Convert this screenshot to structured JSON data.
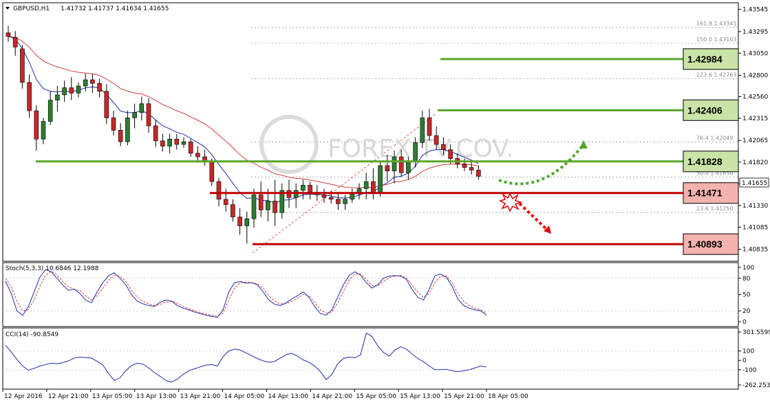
{
  "colors": {
    "bull": "#2e7d32",
    "bear": "#c62828",
    "ma_fast": "#1f2aa8",
    "ma_slow": "#d63b3b",
    "support": "#c00000",
    "resistance": "#5aa42a",
    "box_green": "#c9e4a6",
    "box_red": "#f5b3ad",
    "stoch_main": "#1f2aa8",
    "stoch_signal": "#d63b3b",
    "cci": "#1f2aa8",
    "grid": "#c8c8c8"
  },
  "header": {
    "symbol": "GBPUSD,H1",
    "ohlc": "1.41732 1.41737 1.41634 1.41655"
  },
  "watermark": "FOREX.TV.COV.",
  "price_axis": {
    "min": 1.407,
    "max": 1.4362,
    "ticks": [
      "1.43545",
      "1.43295",
      "1.43050",
      "1.42800",
      "1.42560",
      "1.42315",
      "1.42065",
      "1.41820",
      "1.41575",
      "1.41330",
      "1.41085",
      "1.40835"
    ],
    "current": "1.41655"
  },
  "time_axis": [
    "12 Apr 2016",
    "12 Apr 21:00",
    "13 Apr 05:00",
    "13 Apr 13:00",
    "13 Apr 21:00",
    "14 Apr 05:00",
    "14 Apr 13:00",
    "14 Apr 21:00",
    "15 Apr 05:00",
    "15 Apr 13:00",
    "15 Apr 21:00",
    "18 Apr 05:00"
  ],
  "fib_levels": [
    {
      "label": "161.8  1.43341",
      "price": 1.43341
    },
    {
      "label": "150.0  1.43163",
      "price": 1.43163
    },
    {
      "label": "123.6  1.42763",
      "price": 1.42763
    },
    {
      "label": "76.4  1.42049",
      "price": 1.42049
    },
    {
      "label": "50.0  1.41650",
      "price": 1.4165
    },
    {
      "label": "23.6  1.41250",
      "price": 1.4125
    }
  ],
  "key_levels": [
    {
      "value": "1.42984",
      "price": 1.42984,
      "kind": "resistance"
    },
    {
      "value": "1.42406",
      "price": 1.42406,
      "kind": "resistance"
    },
    {
      "value": "1.41828",
      "price": 1.41828,
      "kind": "resistance"
    },
    {
      "value": "1.41471",
      "price": 1.41471,
      "kind": "support"
    },
    {
      "value": "1.40893",
      "price": 1.40893,
      "kind": "support"
    }
  ],
  "stoch": {
    "label": "Stoch(5,3,3) 10.6846 12.1988",
    "ticks": [
      "100",
      "80",
      "50",
      "20",
      "0"
    ],
    "main": [
      75,
      52,
      20,
      12,
      28,
      55,
      82,
      96,
      92,
      80,
      68,
      58,
      60,
      52,
      40,
      35,
      55,
      72,
      85,
      90,
      80,
      68,
      50,
      38,
      33,
      30,
      28,
      36,
      40,
      38,
      30,
      25,
      22,
      18,
      15,
      12,
      10,
      8,
      22,
      55,
      72,
      74,
      71,
      72,
      68,
      55,
      40,
      32,
      30,
      35,
      42,
      48,
      55,
      45,
      28,
      15,
      12,
      22,
      45,
      68,
      85,
      92,
      86,
      72,
      62,
      68,
      80,
      84,
      85,
      84,
      78,
      60,
      45,
      40,
      60,
      85,
      88,
      82,
      65,
      42,
      30,
      25,
      22,
      20,
      12
    ],
    "signal": [
      80,
      65,
      38,
      20,
      22,
      40,
      65,
      86,
      93,
      86,
      74,
      64,
      60,
      57,
      48,
      40,
      48,
      62,
      76,
      85,
      84,
      74,
      58,
      45,
      38,
      33,
      30,
      32,
      36,
      38,
      34,
      28,
      24,
      20,
      17,
      14,
      12,
      10,
      16,
      40,
      62,
      72,
      73,
      72,
      70,
      62,
      48,
      38,
      33,
      33,
      38,
      44,
      50,
      48,
      36,
      22,
      16,
      18,
      35,
      56,
      76,
      88,
      88,
      78,
      67,
      66,
      74,
      81,
      84,
      85,
      81,
      68,
      54,
      45,
      52,
      72,
      84,
      84,
      72,
      52,
      38,
      30,
      25,
      22,
      16
    ]
  },
  "cci": {
    "label": "CCI(14) -90.8549",
    "ticks": [
      "301.5599",
      "100",
      "0",
      "-100",
      "-262.2536"
    ],
    "values": [
      160,
      90,
      10,
      -60,
      -105,
      -85,
      -60,
      -45,
      -30,
      -35,
      -25,
      -5,
      25,
      35,
      30,
      25,
      -10,
      -50,
      -140,
      -215,
      -185,
      -110,
      -55,
      -30,
      -40,
      -80,
      -130,
      -170,
      -215,
      -230,
      -200,
      -150,
      -110,
      -90,
      -70,
      -50,
      -45,
      -60,
      40,
      100,
      120,
      110,
      80,
      50,
      20,
      -5,
      -20,
      -10,
      25,
      60,
      75,
      45,
      5,
      -20,
      -60,
      -120,
      -205,
      -150,
      -40,
      20,
      35,
      28,
      58,
      290,
      255,
      155,
      85,
      45,
      110,
      145,
      120,
      70,
      20,
      -15,
      -60,
      -100,
      -100,
      -95,
      -110,
      -120,
      -110,
      -100,
      -80,
      -60,
      -70
    ]
  },
  "candles": [
    [
      1.4328,
      1.4336,
      1.4318,
      1.4324
    ],
    [
      1.4323,
      1.433,
      1.4302,
      1.4312
    ],
    [
      1.431,
      1.4314,
      1.4265,
      1.4272
    ],
    [
      1.4272,
      1.4281,
      1.4232,
      1.424
    ],
    [
      1.424,
      1.4246,
      1.4195,
      1.4208
    ],
    [
      1.4208,
      1.4232,
      1.4202,
      1.4228
    ],
    [
      1.4228,
      1.4262,
      1.4224,
      1.4252
    ],
    [
      1.4252,
      1.4268,
      1.4239,
      1.4258
    ],
    [
      1.4258,
      1.4274,
      1.425,
      1.4266
    ],
    [
      1.4266,
      1.4278,
      1.4252,
      1.426
    ],
    [
      1.426,
      1.4272,
      1.4255,
      1.4268
    ],
    [
      1.4268,
      1.4282,
      1.4262,
      1.4275
    ],
    [
      1.4275,
      1.4282,
      1.426,
      1.4271
    ],
    [
      1.4271,
      1.4276,
      1.4255,
      1.4262
    ],
    [
      1.4262,
      1.427,
      1.4225,
      1.4232
    ],
    [
      1.4232,
      1.424,
      1.4212,
      1.4218
    ],
    [
      1.4218,
      1.4226,
      1.42,
      1.4205
    ],
    [
      1.4205,
      1.424,
      1.4201,
      1.4232
    ],
    [
      1.4232,
      1.4248,
      1.422,
      1.4238
    ],
    [
      1.4238,
      1.4256,
      1.4229,
      1.4248
    ],
    [
      1.4248,
      1.4254,
      1.4215,
      1.4223
    ],
    [
      1.4223,
      1.423,
      1.4199,
      1.4206
    ],
    [
      1.4206,
      1.4214,
      1.4194,
      1.42
    ],
    [
      1.42,
      1.4214,
      1.4192,
      1.4208
    ],
    [
      1.4208,
      1.4214,
      1.4196,
      1.4202
    ],
    [
      1.4202,
      1.421,
      1.4198,
      1.4205
    ],
    [
      1.4205,
      1.4208,
      1.4188,
      1.4192
    ],
    [
      1.4192,
      1.42,
      1.4184,
      1.4188
    ],
    [
      1.4188,
      1.4196,
      1.4178,
      1.4182
    ],
    [
      1.4182,
      1.4186,
      1.4155,
      1.416
    ],
    [
      1.416,
      1.4164,
      1.4132,
      1.414
    ],
    [
      1.414,
      1.4152,
      1.4126,
      1.4134
    ],
    [
      1.4134,
      1.414,
      1.4115,
      1.412
    ],
    [
      1.412,
      1.413,
      1.41,
      1.411
    ],
    [
      1.411,
      1.4126,
      1.409,
      1.4118
    ],
    [
      1.4118,
      1.4152,
      1.4108,
      1.4145
    ],
    [
      1.4145,
      1.416,
      1.412,
      1.4128
    ],
    [
      1.4128,
      1.4152,
      1.4115,
      1.4138
    ],
    [
      1.4138,
      1.4162,
      1.411,
      1.4125
    ],
    [
      1.4125,
      1.4158,
      1.4118,
      1.415
    ],
    [
      1.415,
      1.4162,
      1.413,
      1.4142
    ],
    [
      1.4142,
      1.4158,
      1.413,
      1.415
    ],
    [
      1.415,
      1.4162,
      1.414,
      1.4156
    ],
    [
      1.4156,
      1.416,
      1.414,
      1.4148
    ],
    [
      1.4148,
      1.4156,
      1.4138,
      1.4145
    ],
    [
      1.4145,
      1.4152,
      1.4136,
      1.4142
    ],
    [
      1.4142,
      1.415,
      1.4135,
      1.414
    ],
    [
      1.414,
      1.4146,
      1.4128,
      1.4135
    ],
    [
      1.4135,
      1.4145,
      1.4128,
      1.414
    ],
    [
      1.414,
      1.4152,
      1.4136,
      1.4146
    ],
    [
      1.4146,
      1.4158,
      1.414,
      1.4152
    ],
    [
      1.4152,
      1.417,
      1.414,
      1.416
    ],
    [
      1.416,
      1.4175,
      1.414,
      1.4148
    ],
    [
      1.4148,
      1.4182,
      1.4143,
      1.4178
    ],
    [
      1.4178,
      1.419,
      1.416,
      1.4172
    ],
    [
      1.4172,
      1.4195,
      1.4158,
      1.4188
    ],
    [
      1.4188,
      1.4196,
      1.4165,
      1.417
    ],
    [
      1.417,
      1.4188,
      1.4162,
      1.4182
    ],
    [
      1.4182,
      1.421,
      1.4176,
      1.4204
    ],
    [
      1.4204,
      1.424,
      1.4198,
      1.4232
    ],
    [
      1.4232,
      1.4242,
      1.4206,
      1.4212
    ],
    [
      1.4212,
      1.4222,
      1.4196,
      1.4202
    ],
    [
      1.4202,
      1.421,
      1.419,
      1.4196
    ],
    [
      1.4196,
      1.4202,
      1.418,
      1.4186
    ],
    [
      1.4186,
      1.4192,
      1.4175,
      1.418
    ],
    [
      1.418,
      1.4186,
      1.4172,
      1.4176
    ],
    [
      1.4176,
      1.4182,
      1.4168,
      1.4173
    ],
    [
      1.4173,
      1.4178,
      1.4162,
      1.4166
    ]
  ],
  "chart_data": {
    "type": "candlestick",
    "title": "GBPUSD,H1",
    "note": "OHLC in #page-data.candles; overlays: fast/slow moving averages, Fibonacci levels, key support/resistance levels"
  }
}
